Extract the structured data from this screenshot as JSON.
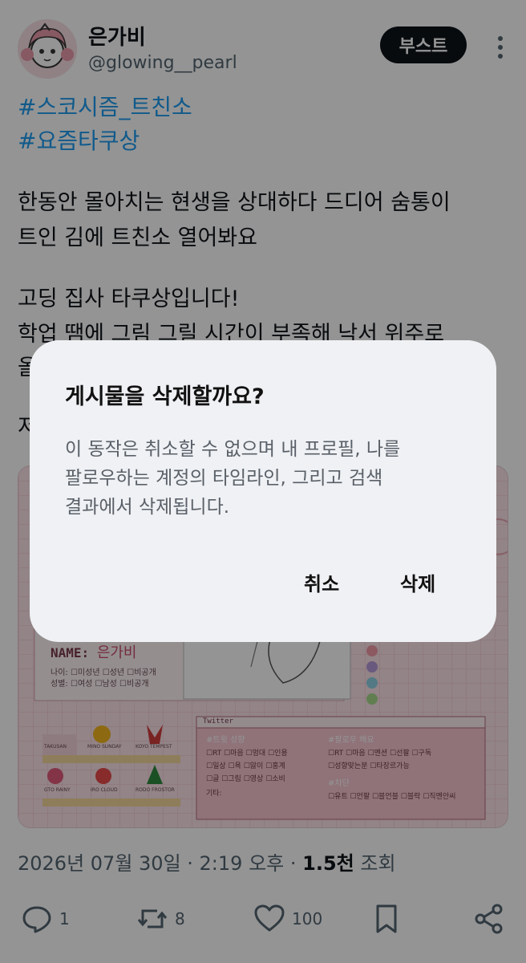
{
  "author": {
    "display_name": "은가비",
    "handle": "@glowing__pearl"
  },
  "toolbar": {
    "boost_label": "부스트",
    "more_icon": "more-vertical-icon"
  },
  "post": {
    "hashtags": [
      "#스코시즘_트친소",
      "#요즘타쿠상"
    ],
    "lines": [
      "한동안 몰아치는 현생을 상대하다 드디어 숨통이",
      "트인 김에 트친소 열어봐요",
      "고딩 집사 타쿠상입니다!",
      "학업 땜에 그림 그릴 시간이 부족해 낙서 위주로",
      "올",
      "저"
    ]
  },
  "media": {
    "name_label": "NAME:",
    "name_value": "은가비",
    "age_row": "나이: ☐미성년 ☐성년 ☐비공개",
    "gender_row": "성별: ☐여성 ☐남성 ☐비공개",
    "panel_title": "Twitter",
    "tweet_style_title": "#트윗 성향",
    "tweet_style_rows": [
      "☐RT ☐마음 ☐멍대 ☐인용",
      "☐일상 ☐욕 ☐앓이 ☐홍계",
      "☐글 ☐그림 ☐영상 ☐소비"
    ],
    "etc_label": "기타:",
    "follow_title": "#팔로우 해요",
    "follow_rows": [
      "☐RT ☐마음 ☐멘션 ☐선팔 ☐구독",
      "☐성향맞는분 ☐타장르가능"
    ],
    "unfollow_title": "#차단",
    "unfollow_row": "☐유트 ☐언팔 ☐블언블 ☐블락 ☐직멘안씨",
    "characters": [
      "TAKUSAN",
      "MINO SUNDAY",
      "KOYO TEMPEST",
      "GTO RAINY",
      "IRO CLOUD",
      "RODO FROSTOR"
    ]
  },
  "meta": {
    "timestamp": "2026년 07월 30일 · 2:19 오후 · ",
    "views_count": "1.5천",
    "views_label": " 조회"
  },
  "actions": {
    "reply_count": "1",
    "repost_count": "8",
    "like_count": "100"
  },
  "dialog": {
    "title": "게시물을 삭제할까요?",
    "message_lines": [
      "이 동작은 취소할 수 없으며 내 프로필, 나를",
      "팔로우하는 계정의 타임라인, 그리고 검색",
      "결과에서 삭제됩니다."
    ],
    "cancel_label": "취소",
    "delete_label": "삭제"
  },
  "colors": {
    "link": "#1d9bf0",
    "text": "#0f1419",
    "muted": "#536471",
    "dialog_bg": "#eff1f4",
    "media_pink": "#fbe3e8"
  }
}
